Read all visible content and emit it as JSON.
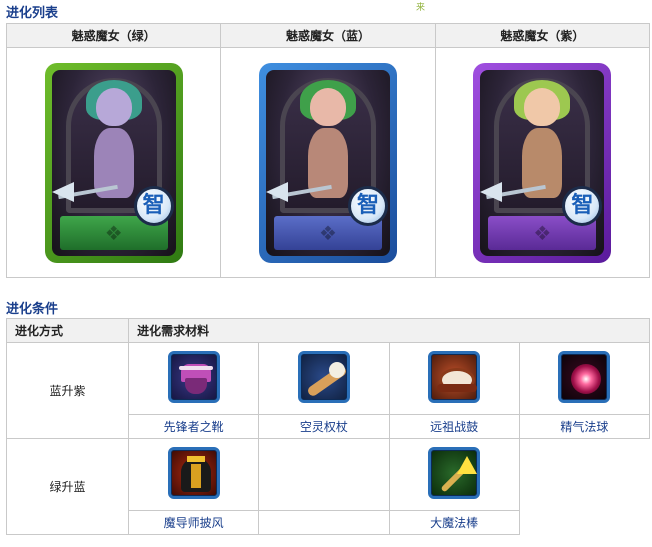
{
  "headings": {
    "evolution_list": "进化列表",
    "evolution_conditions": "进化条件"
  },
  "stray_mark": "来",
  "evolution_list": {
    "forms": [
      {
        "name": "魅惑魔女（绿）",
        "frame_color": "#4fa21f",
        "badge": "智"
      },
      {
        "name": "魅惑魔女（蓝）",
        "frame_color": "#2f6fc8",
        "badge": "智"
      },
      {
        "name": "魅惑魔女（紫）",
        "frame_color": "#7a2fc8",
        "badge": "智"
      }
    ]
  },
  "evolution_conditions": {
    "headers": {
      "method": "进化方式",
      "materials": "进化需求材料"
    },
    "rows": [
      {
        "method": "蓝升紫",
        "materials": [
          {
            "name": "先锋者之靴",
            "icon": "boots-icon"
          },
          {
            "name": "空灵权杖",
            "icon": "staff-icon"
          },
          {
            "name": "远祖战鼓",
            "icon": "drum-icon"
          },
          {
            "name": "精气法球",
            "icon": "orb-icon"
          }
        ]
      },
      {
        "method": "绿升蓝",
        "materials": [
          {
            "name": "魔导师披风",
            "icon": "cloak-icon"
          },
          {
            "name": "",
            "icon": ""
          },
          {
            "name": "大魔法棒",
            "icon": "wand-icon"
          },
          {
            "name": "",
            "icon": ""
          }
        ]
      }
    ]
  },
  "colors": {
    "heading_text": "#1a3f8c",
    "link_text": "#1a3f8c",
    "table_border": "#c9c9c9",
    "header_bg": "#f1f1f1",
    "icon_border": "#2a6fb8"
  }
}
